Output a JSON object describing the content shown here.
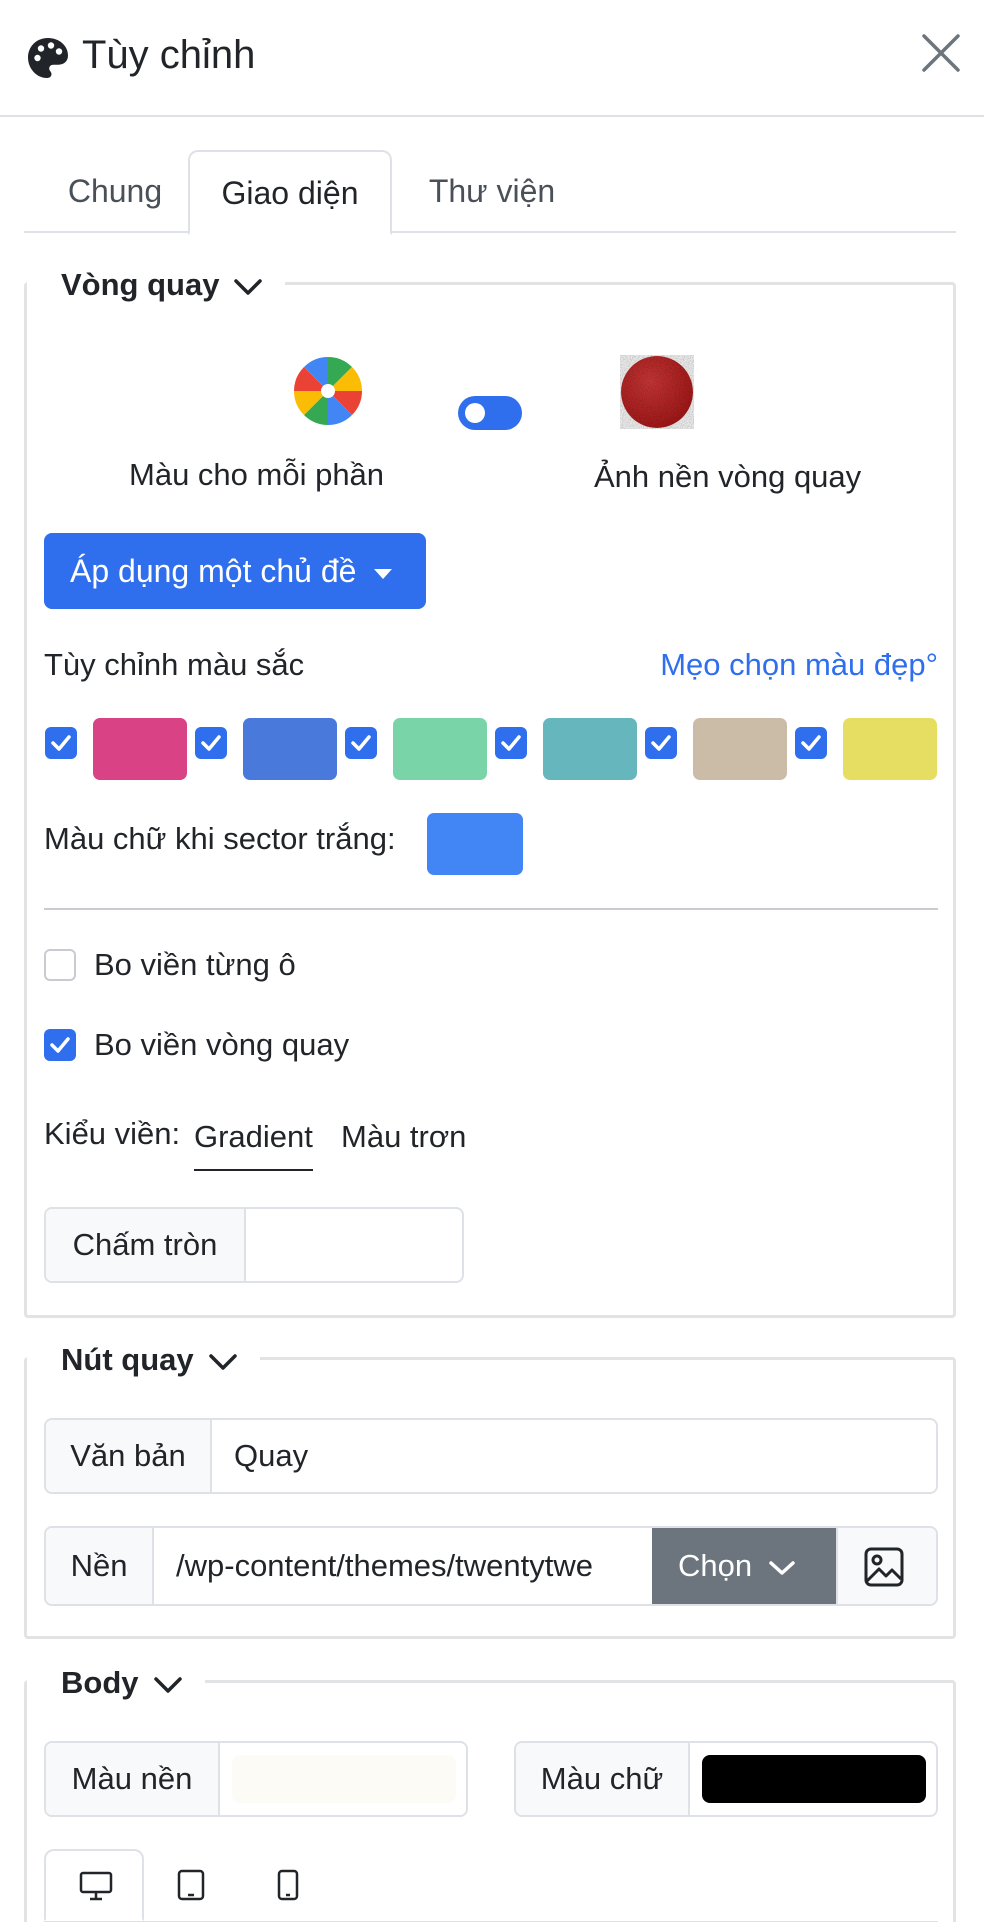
{
  "header": {
    "title": "Tùy chỉnh"
  },
  "tabs": [
    {
      "label": "Chung"
    },
    {
      "label": "Giao diện"
    },
    {
      "label": "Thư viện"
    }
  ],
  "wheel_section": {
    "legend": "Vòng quay",
    "mode_color_label": "Màu cho mỗi phần",
    "mode_image_label": "Ảnh nền vòng quay",
    "mode_toggle_on": true,
    "apply_theme_label": "Áp dụng một chủ đề",
    "custom_color_label": "Tùy chỉnh màu sắc",
    "color_tips_link": "Mẹo chọn màu đẹp°",
    "swatches": [
      {
        "color": "#d94285",
        "checked": true
      },
      {
        "color": "#4879db",
        "checked": true
      },
      {
        "color": "#79d5a7",
        "checked": true
      },
      {
        "color": "#65b6bd",
        "checked": true
      },
      {
        "color": "#cbbca8",
        "checked": true
      },
      {
        "color": "#e5de62",
        "checked": true
      }
    ],
    "white_sector_text_label": "Màu chữ khi sector trắng:",
    "white_sector_text_color": "#4285f4",
    "border_each_label": "Bo viền từng ô",
    "border_each_checked": false,
    "border_wheel_label": "Bo viền vòng quay",
    "border_wheel_checked": true,
    "border_style_label": "Kiểu viền:",
    "border_styles": [
      "Gradient",
      "Màu trơn"
    ],
    "dots_label": "Chấm tròn",
    "dots_value": ""
  },
  "spin_button_section": {
    "legend": "Nút quay",
    "text_label": "Văn bản",
    "text_value": "Quay",
    "bg_label": "Nền",
    "bg_value": "/wp-content/themes/twentytwe",
    "choose_label": "Chọn"
  },
  "body_section": {
    "legend": "Body",
    "bg_color_label": "Màu nền",
    "bg_color": "#fcfbf6",
    "text_color_label": "Màu chữ",
    "text_color": "#000000"
  },
  "colors": {
    "accent": "#2f6fed",
    "secondary": "#6c757d"
  }
}
